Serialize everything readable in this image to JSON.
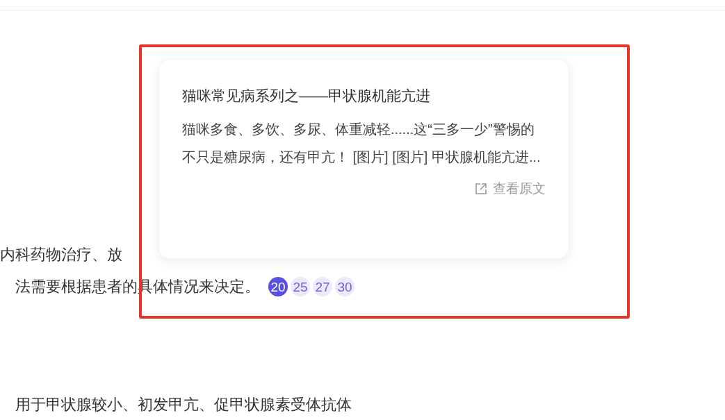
{
  "answer": {
    "lines": [
      "内科药物治疗、放",
      "法需要根据患者的具体情况来决定。"
    ],
    "citations": [
      {
        "label": "20",
        "selected": true
      },
      {
        "label": "25",
        "selected": false
      },
      {
        "label": "27",
        "selected": false
      },
      {
        "label": "30",
        "selected": false
      }
    ],
    "next_line": "用于甲状腺较小、初发甲亢、促甲状腺素受体抗体"
  },
  "preview_card": {
    "title": "猫咪常见病系列之——甲状腺机能亢进",
    "excerpt": "猫咪多食、多饮、多尿、体重减轻......这“三多一少”警惕的不只是糖尿病，还有甲亢！ [图片] [图片] 甲状腺机能亢进...",
    "link": "查看原文"
  }
}
